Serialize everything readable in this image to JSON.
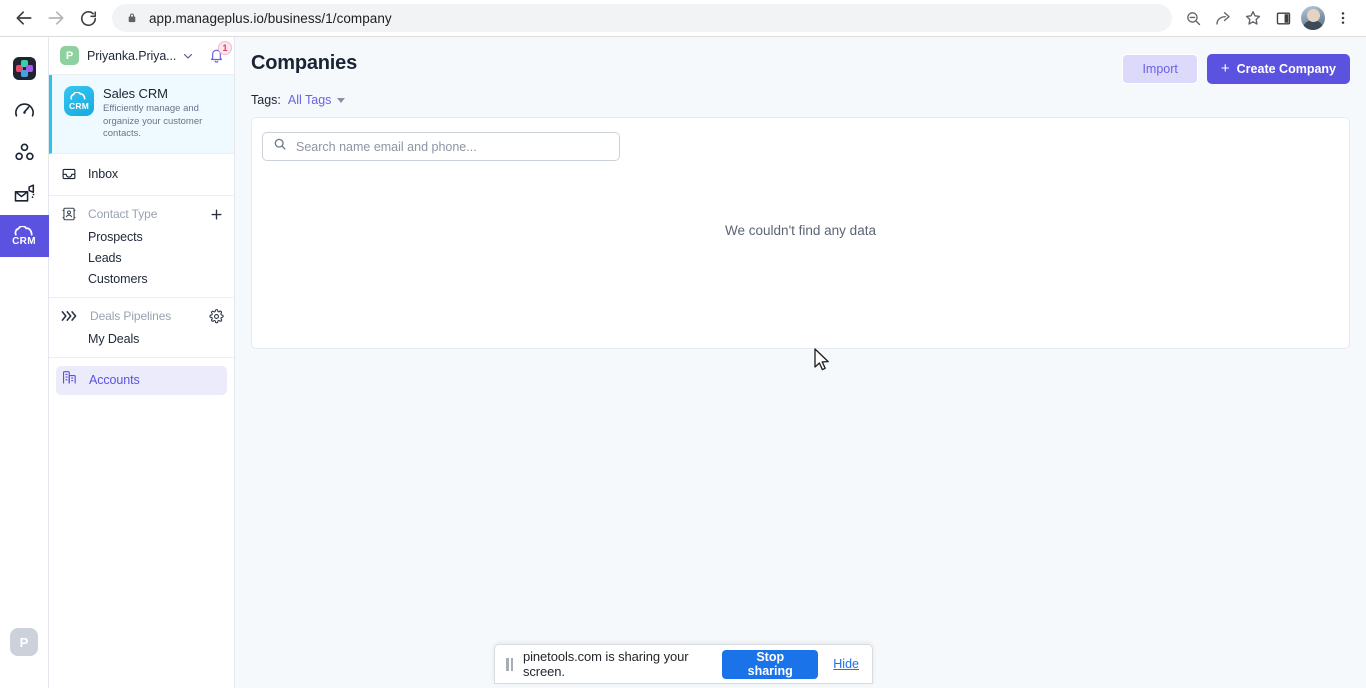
{
  "browser": {
    "back_icon": "back-arrow-icon",
    "forward_icon": "forward-arrow-icon",
    "reload_icon": "reload-icon",
    "lock_icon": "lock-icon",
    "url": "app.manageplus.io/business/1/company",
    "zoom_out_icon": "zoom-out-icon",
    "share_icon": "share-icon",
    "bookmark_icon": "star-icon",
    "sidepanel_icon": "side-panel-icon",
    "profile_icon": "profile-avatar",
    "menu_icon": "three-dot-menu-icon"
  },
  "app_rail": {
    "items": [
      {
        "name": "logo",
        "icon": "app-logo-icon",
        "label": ""
      },
      {
        "name": "dashboard",
        "icon": "speedometer-icon",
        "label": ""
      },
      {
        "name": "teams",
        "icon": "people-group-icon",
        "label": ""
      },
      {
        "name": "campaigns",
        "icon": "mail-megaphone-icon",
        "label": ""
      },
      {
        "name": "crm",
        "icon": "crm-cloud-icon",
        "label": "CRM"
      }
    ],
    "bottom_avatar": "P"
  },
  "sidebar": {
    "workspace": {
      "avatar_letter": "P",
      "name": "Priyanka.Priya...",
      "caret_icon": "chevron-down-icon",
      "bell_icon": "bell-icon",
      "bell_badge": "1"
    },
    "app_card": {
      "icon_label": "CRM",
      "title": "Sales CRM",
      "description": "Efficiently manage and organize your customer contacts."
    },
    "inbox": {
      "label": "Inbox",
      "icon": "inbox-tray-icon"
    },
    "contact_type": {
      "label": "Contact Type",
      "icon": "contact-card-icon",
      "action_icon": "plus-icon",
      "items": [
        "Prospects",
        "Leads",
        "Customers"
      ]
    },
    "deals_pipelines": {
      "label": "Deals Pipelines",
      "icon": "pipeline-chevrons-icon",
      "action_icon": "gear-icon",
      "items": [
        "My Deals"
      ]
    },
    "accounts": {
      "label": "Accounts",
      "icon": "building-icon"
    }
  },
  "main": {
    "page_title": "Companies",
    "import_label": "Import",
    "create_label": "Create Company",
    "create_icon": "plus-icon",
    "tags_label": "Tags:",
    "tags_value": "All Tags",
    "tags_caret_icon": "caret-down-icon",
    "search": {
      "placeholder": "Search name email and phone...",
      "value": "",
      "icon": "search-icon"
    },
    "empty_message": "We couldn't find any data"
  },
  "share_bar": {
    "pause_icon": "pause-icon",
    "message": "pinetools.com is sharing your screen.",
    "stop_label": "Stop sharing",
    "hide_label": "Hide"
  },
  "colors": {
    "brand_purple": "#5b52e0",
    "accent_cyan": "#2ec1ea",
    "chrome_blue": "#1a73e8",
    "page_bg": "#f6f9fc",
    "badge_pink": "#d4446b"
  }
}
